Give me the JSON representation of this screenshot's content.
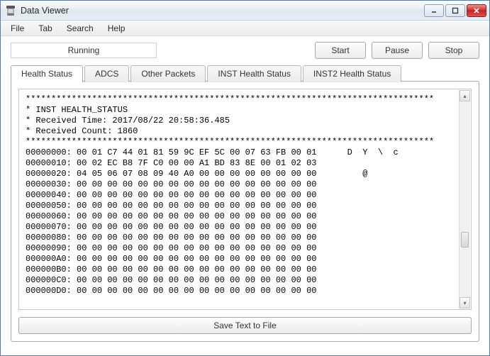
{
  "window": {
    "title": "Data Viewer"
  },
  "menu": {
    "file": "File",
    "tab": "Tab",
    "search": "Search",
    "help": "Help"
  },
  "toolbar": {
    "status": "Running",
    "start": "Start",
    "pause": "Pause",
    "stop": "Stop"
  },
  "tabs": {
    "t0": "Health Status",
    "t1": "ADCS",
    "t2": "Other Packets",
    "t3": "INST Health Status",
    "t4": "INST2 Health Status"
  },
  "packet": {
    "stars_top": "********************************************************************************",
    "name_line": "* INST HEALTH_STATUS",
    "time_line": "* Received Time: 2017/08/22 20:58:36.485",
    "count_line": "* Received Count: 1860",
    "stars_bottom": "********************************************************************************",
    "rows": {
      "r00": "00000000: 00 01 C7 44 01 81 59 9C EF 5C 00 07 63 FB 00 01      D  Y  \\  c    ",
      "r01": "00000010: 00 02 EC B8 7F C0 00 00 A1 BD 83 8E 00 01 02 03",
      "r02": "00000020: 04 05 06 07 08 09 40 A0 00 00 00 00 00 00 00 00         @         ",
      "r03": "00000030: 00 00 00 00 00 00 00 00 00 00 00 00 00 00 00 00",
      "r04": "00000040: 00 00 00 00 00 00 00 00 00 00 00 00 00 00 00 00",
      "r05": "00000050: 00 00 00 00 00 00 00 00 00 00 00 00 00 00 00 00",
      "r06": "00000060: 00 00 00 00 00 00 00 00 00 00 00 00 00 00 00 00",
      "r07": "00000070: 00 00 00 00 00 00 00 00 00 00 00 00 00 00 00 00",
      "r08": "00000080: 00 00 00 00 00 00 00 00 00 00 00 00 00 00 00 00",
      "r09": "00000090: 00 00 00 00 00 00 00 00 00 00 00 00 00 00 00 00",
      "r0A": "000000A0: 00 00 00 00 00 00 00 00 00 00 00 00 00 00 00 00",
      "r0B": "000000B0: 00 00 00 00 00 00 00 00 00 00 00 00 00 00 00 00",
      "r0C": "000000C0: 00 00 00 00 00 00 00 00 00 00 00 00 00 00 00 00",
      "r0D": "000000D0: 00 00 00 00 00 00 00 00 00 00 00 00 00 00 00 00"
    }
  },
  "actions": {
    "save": "Save Text to File"
  }
}
